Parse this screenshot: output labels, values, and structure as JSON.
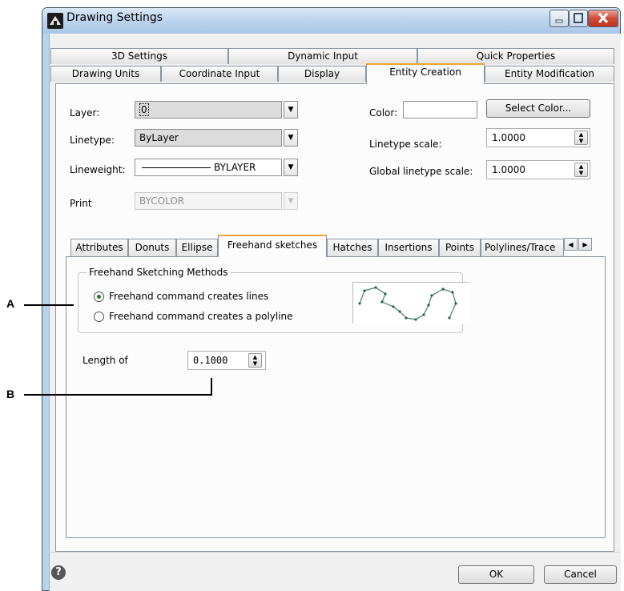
{
  "window": {
    "title": "Drawing Settings"
  },
  "top_tabs": {
    "row1": [
      "3D Settings",
      "Dynamic Input",
      "Quick Properties"
    ],
    "row2": [
      "Drawing Units",
      "Coordinate Input",
      "Display",
      "Entity Creation",
      "Entity Modification"
    ],
    "active": "Entity Creation"
  },
  "entity": {
    "layer_label": "Layer:",
    "layer_value": "0",
    "linetype_label": "Linetype:",
    "linetype_value": "ByLayer",
    "lineweight_label": "Lineweight:",
    "lineweight_value": "BYLAYER",
    "print_label": "Print",
    "print_value": "BYCOLOR",
    "color_label": "Color:",
    "color_value": "",
    "select_color_label": "Select Color...",
    "linetype_scale_label": "Linetype scale:",
    "linetype_scale_value": "1.0000",
    "global_scale_label": "Global linetype scale:",
    "global_scale_value": "1.0000"
  },
  "inner_tabs": {
    "items": [
      "Attributes",
      "Donuts",
      "Ellipse",
      "Freehand sketches",
      "Hatches",
      "Insertions",
      "Points",
      "Polylines/Trace"
    ],
    "active": "Freehand sketches"
  },
  "freehand": {
    "group_title": "Freehand Sketching Methods",
    "option_lines": "Freehand command creates lines",
    "option_polyline": "Freehand command creates a polyline",
    "selected": "lines",
    "length_label": "Length of",
    "length_value": "0.1000"
  },
  "callouts": {
    "a": "A",
    "b": "B"
  },
  "buttons": {
    "ok": "OK",
    "cancel": "Cancel"
  },
  "icons": [
    "app-icon",
    "minimize-icon",
    "maximize-icon",
    "close-icon",
    "help-icon",
    "dropdown-arrow-icon",
    "spin-icon",
    "tab-scroll-left-icon",
    "tab-scroll-right-icon"
  ]
}
